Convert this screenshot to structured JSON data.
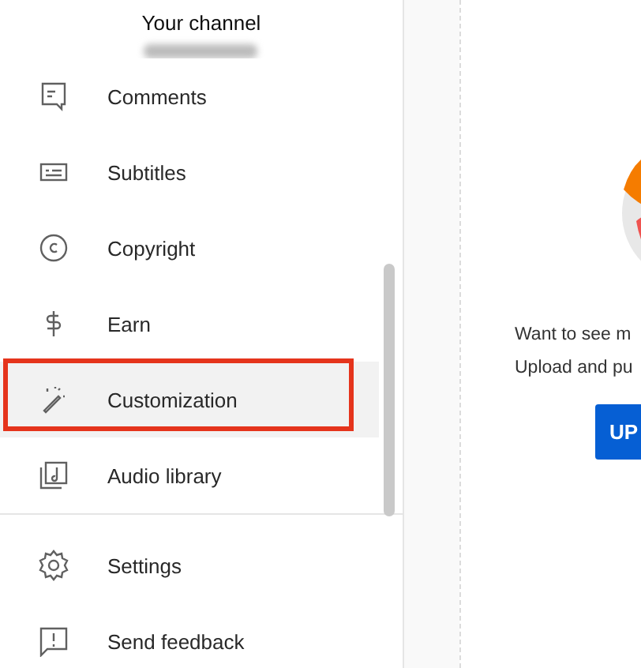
{
  "sidebar": {
    "header": {
      "title": "Your channel"
    },
    "items": [
      {
        "kind": "comments",
        "label": "Comments",
        "selected": false,
        "outlined": false
      },
      {
        "kind": "subtitles",
        "label": "Subtitles",
        "selected": false,
        "outlined": false
      },
      {
        "kind": "copyright",
        "label": "Copyright",
        "selected": false,
        "outlined": false
      },
      {
        "kind": "earn",
        "label": "Earn",
        "selected": false,
        "outlined": false
      },
      {
        "kind": "customization",
        "label": "Customization",
        "selected": true,
        "outlined": true
      },
      {
        "kind": "audio",
        "label": "Audio library",
        "selected": false,
        "outlined": false
      }
    ],
    "footer_items": [
      {
        "kind": "settings",
        "label": "Settings",
        "selected": false,
        "outlined": false
      },
      {
        "kind": "feedback",
        "label": "Send feedback",
        "selected": false,
        "outlined": false
      }
    ]
  },
  "main": {
    "lines": [
      "Want to see m",
      "Upload and pu"
    ],
    "button": "UP"
  }
}
